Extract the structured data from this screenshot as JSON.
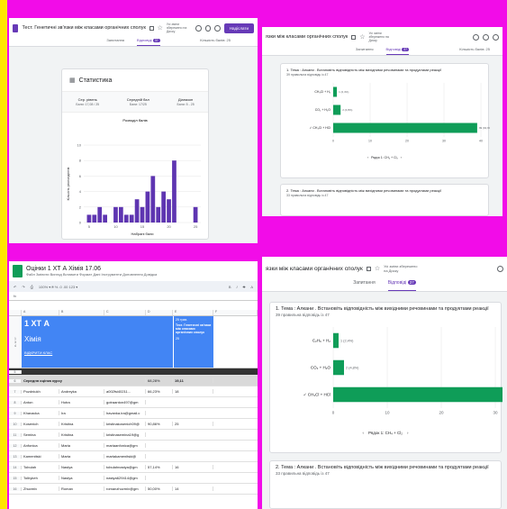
{
  "panel1": {
    "form_title": "Тест. Генетичні зв'язки між класами органічних сполук",
    "saved": "Усі зміни збережено на Диску",
    "send_label": "Надіслати",
    "tabs": [
      "Запитання",
      "Відповіді",
      "Кількість балів: 25"
    ],
    "responses_count": "37",
    "stats_title": "Статистика",
    "stats": [
      {
        "label": "Сер. рівень",
        "value": "Бали: 17,08 / 25"
      },
      {
        "label": "Середній бал",
        "value": "Бали: 17/25"
      },
      {
        "label": "Діапазон",
        "value": "Бали: 5 - 25"
      }
    ],
    "hist_title": "Розподіл балів",
    "hist_ylabel": "Кількість респондентів",
    "hist_xlabel": "Набрані бали"
  },
  "panel2": {
    "form_title": "язки між класами органічних сполук",
    "saved": "Усі зміни збережено на Диску",
    "tabs": [
      "Запитання",
      "Відповіді",
      "Кількість балів: 25"
    ],
    "responses_count": "37",
    "q1_title": "1. Тема : Алкани . Встановіть відповідність між вихідними речовинами та продуктами реакції",
    "q1_sub": "39 правильна відповідь із 47",
    "pager": "Рядок 1: CH₄ + Cl₂",
    "q2_title": "2. Тема : Алкани . Встановіть відповідність між вихідними речовинами та продуктами реакції",
    "q2_sub": "33 правильна відповідь із 47"
  },
  "panel3": {
    "title": "Оцінки 1 ХТ А Хімія 17.06",
    "menu": "Файл  Змінити  Вигляд  Вставити  Формат  Дані  Інструменти  Доповнення  Довідка",
    "toolbar": "100%  ▾   ₴  %  .0  .00  123 ▾",
    "fx": "fx",
    "columns": [
      "",
      "A",
      "B",
      "C",
      "D",
      "E",
      "F"
    ],
    "class_name": "1 ХТ А",
    "subject": "Хімія",
    "link": "ВІДКРИТИ КЛАС",
    "test_title": "Тест. Генетичні зв'язки між класами органічних сполук",
    "test_date": "25 трав.",
    "test_max": "25",
    "avg_label": "Середня оцінка курсу",
    "avg_value": "68,28%",
    "avg_test": "19,11",
    "rows": [
      {
        "n": "7",
        "a": "Pozdniukh",
        "b": "Andreyka",
        "c": "a002fsi40211...",
        "d": "66,23%",
        "e": "18"
      },
      {
        "n": "8",
        "a": "Anton",
        "b": "Hotra",
        "c": "gotraanton497@gm",
        "d": "",
        "e": ""
      },
      {
        "n": "9",
        "a": "Khavacka",
        "b": "Ira",
        "c": "havanka.ira@gmail.c",
        "d": "",
        "e": ""
      },
      {
        "n": "10",
        "a": "Kosenich",
        "b": "Kristina",
        "c": "kristinakosenich09@",
        "d": "90,86%",
        "e": "25"
      },
      {
        "n": "11",
        "a": "Semina",
        "b": "Kristina",
        "c": "kristinasemina19@g",
        "d": "",
        "e": ""
      },
      {
        "n": "12",
        "a": "Anfonica",
        "b": "Maria",
        "c": "mariaanfonica@gm",
        "d": "",
        "e": ""
      },
      {
        "n": "13",
        "a": "Kamenitski",
        "b": "Marta",
        "c": "martakamenitski@",
        "d": "",
        "e": ""
      },
      {
        "n": "14",
        "a": "Tobulah",
        "b": "Nastya",
        "c": "tobulahnastya@gm",
        "d": "57,14%",
        "e": "16"
      },
      {
        "n": "15",
        "a": "Tolbykeh",
        "b": "Nastya",
        "c": "nastya629414@gm",
        "d": "",
        "e": ""
      },
      {
        "n": "16",
        "a": "Zhuvmiv",
        "b": "Roman",
        "c": "romanzhuvmiv@gm",
        "d": "50,00%",
        "e": "14"
      }
    ]
  },
  "panel4": {
    "form_title": "язки між класами органічних сполук",
    "saved": "Усі зміни збережено на Диску",
    "tabs": [
      "Запитання",
      "Відповіді"
    ],
    "responses_count": "37",
    "q1_title": "1. Тема : Алкани . Встановіть відповідність між вихідними речовинами та продуктами реакції",
    "q1_sub": "39 правильна відповідь із 47",
    "pager": "Рядок 1:  CH₄ + Cl₂",
    "q2_title": "2. Тема : Алкани . Встановіть відповідність між вихідними речовинами та продуктами реакції",
    "q2_sub": "33 правильна відповідь із 47"
  },
  "chart_data": [
    {
      "type": "bar",
      "title": "Розподіл балів",
      "xlabel": "Набрані бали",
      "ylabel": "Кількість респондентів",
      "x": [
        5,
        6,
        7,
        8,
        9,
        10,
        11,
        12,
        13,
        14,
        15,
        16,
        17,
        18,
        19,
        20,
        21,
        22,
        23,
        24,
        25
      ],
      "values": [
        1,
        1,
        2,
        1,
        0,
        2,
        2,
        1,
        1,
        3,
        2,
        4,
        6,
        2,
        4,
        3,
        8,
        0,
        0,
        0,
        2
      ],
      "ylim": [
        0,
        10
      ],
      "xticks": [
        "5",
        "10",
        "15",
        "20",
        "25"
      ],
      "yticks": [
        "0",
        "2",
        "4",
        "6",
        "8",
        "10"
      ],
      "color": "#5e35b1"
    },
    {
      "type": "bar",
      "orientation": "horizontal",
      "categories": [
        "CH₃Cl + H₂",
        "CO₂ + H₂O",
        "✓ CH₃Cl + HCl"
      ],
      "values": [
        1,
        2,
        39
      ],
      "labels": [
        "1 (2,4%)",
        "2 (4,8%)",
        "39 (92,9%)"
      ],
      "xlim": [
        0,
        40
      ],
      "xticks": [
        "0",
        "10",
        "20",
        "30",
        "40"
      ],
      "color": "#0f9d58"
    },
    {
      "type": "bar",
      "orientation": "horizontal",
      "categories": [
        "C₂H₆ + H₂",
        "CO₂ + H₂O",
        "✓ CH₃Cl + HCl"
      ],
      "values": [
        1,
        2,
        39
      ],
      "labels": [
        "1 (2,4%)",
        "2 (4,8%)",
        ""
      ],
      "xlim": [
        0,
        30
      ],
      "xticks": [
        "0",
        "10",
        "20",
        "30"
      ],
      "color": "#0f9d58"
    }
  ]
}
